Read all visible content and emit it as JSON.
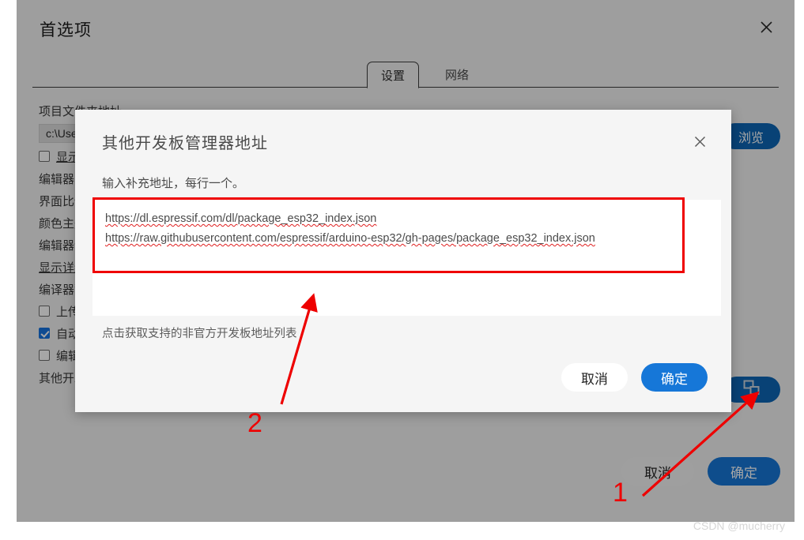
{
  "window": {
    "title": "首选项",
    "close_icon": "close-icon"
  },
  "tabs": [
    {
      "label": "设置",
      "active": true
    },
    {
      "label": "网络",
      "active": false
    }
  ],
  "settings": {
    "rows": [
      {
        "type": "label",
        "text": "项目文件夹地址"
      },
      {
        "type": "path",
        "text": "c:\\Users\\Administrator\\Documents\\Arduino"
      },
      {
        "type": "checkbox",
        "checked": false,
        "text": "显示详细输出"
      },
      {
        "type": "label",
        "text": "编辑器字体大小"
      },
      {
        "type": "label",
        "text": "界面比例缩放"
      },
      {
        "type": "label",
        "text": "颜色主题"
      },
      {
        "type": "label",
        "text": "编辑器语言"
      },
      {
        "type": "link",
        "text": "显示详细输出"
      },
      {
        "type": "label",
        "text": "编译器警告"
      },
      {
        "type": "checkbox",
        "checked": false,
        "text": "上传后验证代码"
      },
      {
        "type": "checkbox",
        "checked": true,
        "text": "自动保存"
      },
      {
        "type": "checkbox",
        "checked": false,
        "text": "编辑器快速建议"
      },
      {
        "type": "label",
        "text": "其他开发板管理器地址"
      }
    ],
    "browse_button": "浏览",
    "edit_urls_icon": "external-window-icon",
    "footer": {
      "cancel": "取消",
      "confirm": "确定"
    }
  },
  "modal": {
    "title": "其他开发板管理器地址",
    "close_icon": "close-icon",
    "description": "输入补充地址，每行一个。",
    "textarea": {
      "placeholder": "",
      "lines": [
        "https://dl.espressif.com/dl/package_esp32_index.json",
        "https://raw.githubusercontent.com/espressif/arduino-esp32/gh-pages/package_esp32_index.json"
      ],
      "value": "https://dl.espressif.com/dl/package_esp32_index.json\nhttps://raw.githubusercontent.com/espressif/arduino-esp32/gh-pages/package_esp32_index.json"
    },
    "helper_link": "点击获取支持的非官方开发板地址列表",
    "cancel": "取消",
    "confirm": "确定"
  },
  "annotations": {
    "step_one": "1",
    "step_two": "2",
    "highlight_color": "#ef0000",
    "arrow_color": "#ee0000"
  },
  "watermark": "CSDN @mucherry",
  "colors": {
    "accent_blue": "#1677d8",
    "dark_blue": "#0d66b5",
    "annotation_red": "#ef0000",
    "window_bg": "#f3f3f3",
    "modal_bg": "#f5f5f5"
  }
}
